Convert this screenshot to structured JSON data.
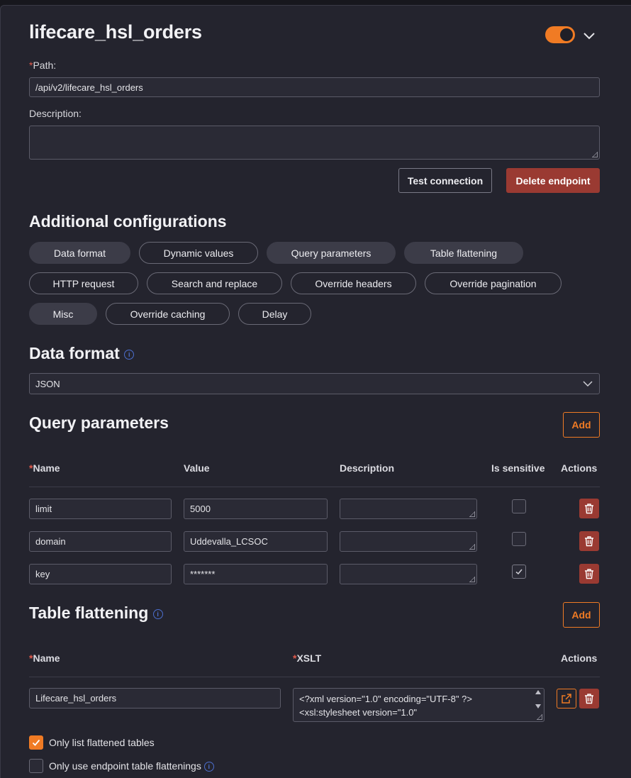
{
  "header": {
    "title": "lifecare_hsl_orders",
    "enabled": true
  },
  "path": {
    "label": "Path:",
    "required_marker": "*",
    "value": "/api/v2/lifecare_hsl_orders"
  },
  "description": {
    "label": "Description:",
    "value": ""
  },
  "actions": {
    "test_label": "Test connection",
    "delete_label": "Delete endpoint"
  },
  "additional": {
    "title": "Additional configurations",
    "chips": [
      {
        "label": "Data format",
        "active": true
      },
      {
        "label": "Dynamic values",
        "active": false
      },
      {
        "label": "Query parameters",
        "active": true
      },
      {
        "label": "Table flattening",
        "active": true
      },
      {
        "label": "HTTP request",
        "active": false
      },
      {
        "label": "Search and replace",
        "active": false
      },
      {
        "label": "Override headers",
        "active": false
      },
      {
        "label": "Override pagination",
        "active": false
      },
      {
        "label": "Misc",
        "active": true
      },
      {
        "label": "Override caching",
        "active": false
      },
      {
        "label": "Delay",
        "active": false
      }
    ]
  },
  "data_format": {
    "title": "Data format",
    "info_glyph": "i",
    "selected": "JSON"
  },
  "query_params": {
    "title": "Query parameters",
    "add_label": "Add",
    "headers": {
      "name": "Name",
      "value": "Value",
      "description": "Description",
      "sensitive": "Is sensitive",
      "actions": "Actions"
    },
    "rows": [
      {
        "name": "limit",
        "value": "5000",
        "description": "",
        "sensitive": false
      },
      {
        "name": "domain",
        "value": "Uddevalla_LCSOC",
        "description": "",
        "sensitive": false
      },
      {
        "name": "key",
        "value": "*******",
        "description": "",
        "sensitive": true
      }
    ]
  },
  "table_flattening": {
    "title": "Table flattening",
    "info_glyph": "i",
    "add_label": "Add",
    "headers": {
      "name": "Name",
      "xslt": "XSLT",
      "actions": "Actions"
    },
    "rows": [
      {
        "name": "Lifecare_hsl_orders",
        "xslt_line1": "<?xml version=\"1.0\" encoding=\"UTF-8\" ?>",
        "xslt_line2": "<xsl:stylesheet version=\"1.0\""
      }
    ]
  },
  "options": {
    "only_list_flattened": {
      "label": "Only list flattened tables",
      "checked": true
    },
    "only_use_endpoint": {
      "label": "Only use endpoint table flattenings",
      "checked": false,
      "info_glyph": "i"
    }
  },
  "colors": {
    "accent": "#f07b24",
    "danger": "#9a3a32",
    "background": "#24242e",
    "info": "#4c6fcf"
  }
}
